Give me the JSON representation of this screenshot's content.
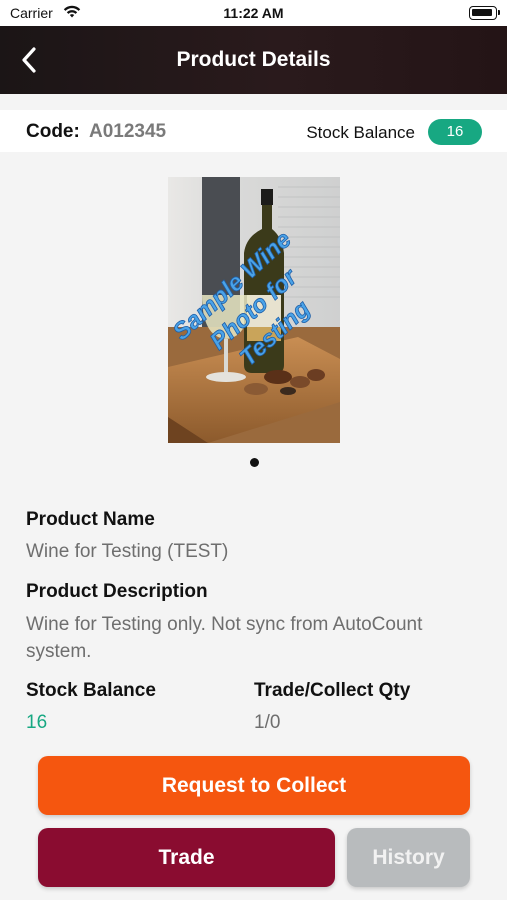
{
  "status_bar": {
    "carrier": "Carrier",
    "time": "11:22 AM"
  },
  "nav": {
    "title": "Product Details",
    "back_icon": "chevron-left-icon"
  },
  "code_bar": {
    "code_label": "Code:",
    "code_value": "A012345",
    "stock_balance_label": "Stock Balance",
    "stock_balance_value": "16"
  },
  "image": {
    "watermark_lines": [
      "Sample Wine",
      "Photo for",
      "Testing"
    ],
    "page_count": 1,
    "current_page": 1
  },
  "details": {
    "product_name_label": "Product Name",
    "product_name_value": "Wine for Testing (TEST)",
    "product_description_label": "Product Description",
    "product_description_value": "Wine for Testing only. Not sync from AutoCount system.",
    "stock_balance_label": "Stock Balance",
    "stock_balance_value": "16",
    "trade_collect_label": "Trade/Collect Qty",
    "trade_collect_value": "1/0"
  },
  "buttons": {
    "request_collect": "Request to Collect",
    "trade": "Trade",
    "history": "History"
  },
  "colors": {
    "accent_green": "#17a882",
    "collect_orange": "#f5560f",
    "trade_maroon": "#8a0c30",
    "history_gray": "#b8bbbd",
    "nav_dark": "#1b1516"
  }
}
